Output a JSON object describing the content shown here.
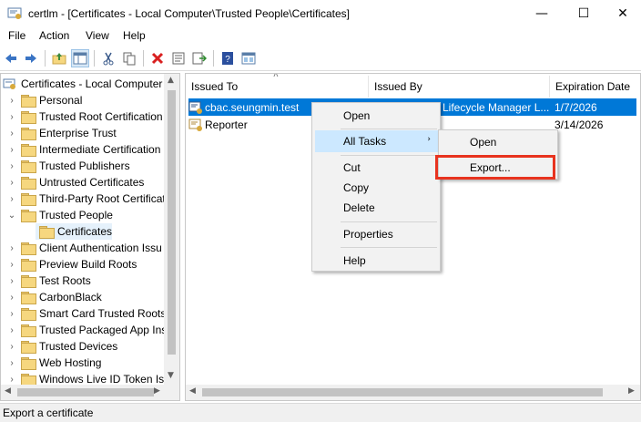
{
  "window": {
    "title": "certlm - [Certificates - Local Computer\\Trusted People\\Certificates]",
    "minimize": "—",
    "maximize": "☐",
    "close": "✕"
  },
  "menubar": {
    "items": [
      "File",
      "Action",
      "View",
      "Help"
    ]
  },
  "toolbar": {
    "icons": [
      "back-arrow-icon",
      "forward-arrow-icon",
      "folder-up-icon",
      "show-hide-tree-icon",
      "cut-icon",
      "copy-icon",
      "delete-icon",
      "properties-icon",
      "export-list-icon",
      "help-icon",
      "console-icon"
    ]
  },
  "tree": {
    "root": "Certificates - Local Computer",
    "items": [
      {
        "label": "Personal",
        "expanded": false
      },
      {
        "label": "Trusted Root Certification",
        "expanded": false
      },
      {
        "label": "Enterprise Trust",
        "expanded": false
      },
      {
        "label": "Intermediate Certification",
        "expanded": false
      },
      {
        "label": "Trusted Publishers",
        "expanded": false
      },
      {
        "label": "Untrusted Certificates",
        "expanded": false
      },
      {
        "label": "Third-Party Root Certificat",
        "expanded": false
      },
      {
        "label": "Trusted People",
        "expanded": true
      },
      {
        "label": "Certificates",
        "child": true,
        "selected": true
      },
      {
        "label": "Client Authentication Issu",
        "expanded": false
      },
      {
        "label": "Preview Build Roots",
        "expanded": false
      },
      {
        "label": "Test Roots",
        "expanded": false
      },
      {
        "label": "CarbonBlack",
        "expanded": false
      },
      {
        "label": "Smart Card Trusted Roots",
        "expanded": false
      },
      {
        "label": "Trusted Packaged App Ins",
        "expanded": false
      },
      {
        "label": "Trusted Devices",
        "expanded": false
      },
      {
        "label": "Web Hosting",
        "expanded": false
      },
      {
        "label": "Windows Live ID Token Iss",
        "expanded": false
      }
    ]
  },
  "list": {
    "columns": [
      "Issued To",
      "Issued By",
      "Expiration Date"
    ],
    "rows": [
      {
        "issued_to": "cbac.seungmin.test",
        "issued_by": "Lifecycle Manager L...",
        "expiration": "1/7/2026",
        "selected": true
      },
      {
        "issued_to": "Reporter",
        "issued_by": "",
        "expiration": "3/14/2026",
        "selected": false
      }
    ]
  },
  "context_menu": {
    "open": "Open",
    "all_tasks": "All Tasks",
    "cut": "Cut",
    "copy": "Copy",
    "delete": "Delete",
    "properties": "Properties",
    "help": "Help"
  },
  "submenu": {
    "open": "Open",
    "export": "Export..."
  },
  "status": {
    "text": "Export a certificate"
  },
  "colors": {
    "selection": "#0078d7",
    "menu_highlight": "#cce8ff",
    "annotation": "#e8331f"
  }
}
